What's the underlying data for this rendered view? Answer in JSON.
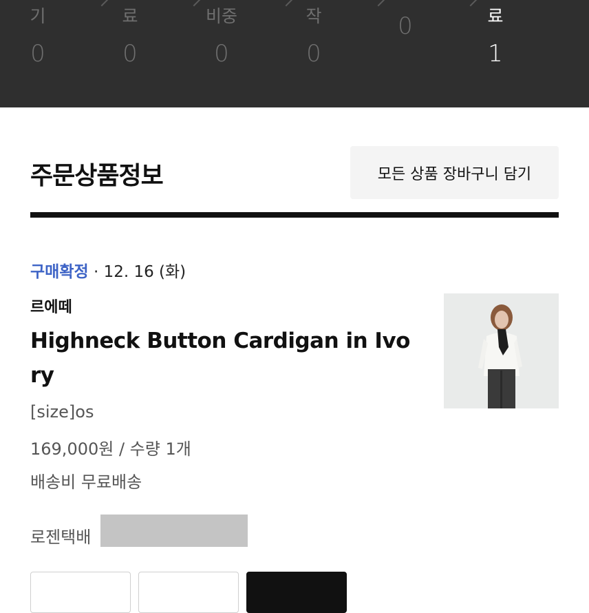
{
  "order_status_bar": {
    "steps": [
      {
        "label": "기",
        "count": "0"
      },
      {
        "label": "료",
        "count": "0"
      },
      {
        "label": "비중",
        "count": "0"
      },
      {
        "label": "작",
        "count": "0"
      },
      {
        "label": "",
        "count": "0"
      },
      {
        "label": "료",
        "count": "1"
      }
    ]
  },
  "section": {
    "title": "주문상품정보",
    "add_all_to_cart_label": "모든 상품 장바구니 담기"
  },
  "order": {
    "status": "구매확정",
    "date": " · 12. 16 (화)",
    "brand": "르에떼",
    "product_name": "Highneck Button Cardigan in Ivory",
    "option": "[size]os",
    "price_qty": "169,000원 / 수량 1개",
    "shipping": "배송비 무료배송",
    "carrier": "로젠택배"
  },
  "colors": {
    "status_bar_bg": "#2f2f2f",
    "status_accent": "#3d63c6"
  }
}
